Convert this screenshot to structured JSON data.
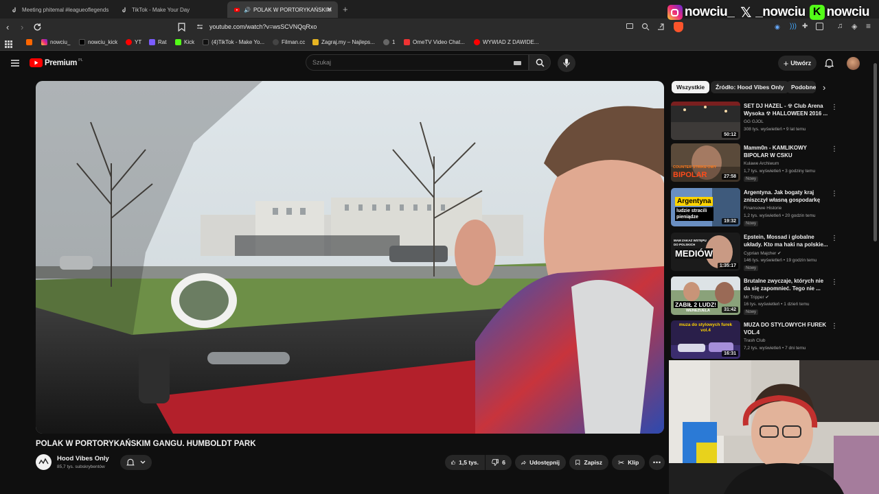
{
  "tabs": [
    {
      "label": "Meeting phitemal #leagueoflegends",
      "active": false
    },
    {
      "label": "TikTok - Make Your Day",
      "active": false
    },
    {
      "label": "POLAK W PORTORYKAŃSKIM",
      "active": true
    }
  ],
  "address": {
    "url": "youtube.com/watch?v=wsSCVNQqRxo"
  },
  "bookmarks": [
    "nowciu_",
    "nowciu_kick",
    "YT",
    "Rat",
    "Kick",
    "(4)TikTok - Make Yo...",
    "Filman.cc",
    "Zagraj.my – Najleps...",
    "1",
    "OmeTV Video Chat...",
    "WYWIAD Z DAWIDE..."
  ],
  "youtube": {
    "logo_text": "Premium",
    "logo_sup": "PL",
    "search_placeholder": "Szukaj",
    "create_label": "Utwórz"
  },
  "chips": [
    "Wszystkie",
    "Źródło: Hood Vibes Only",
    "Podobne"
  ],
  "recommendations": [
    {
      "title": "SET DJ HAZEL - ☢ Club Arena Wysoka ☢ HALLOWEEN 2016 ...",
      "channel": "GG GJOL",
      "meta": "308 tys. wyświetleń • 9 lat temu",
      "duration": "50:12",
      "badge": "",
      "verified": false
    },
    {
      "title": "Mamm0n - KAMLIKOWY BIPOLAR W CSKU",
      "channel": "Kulawe Archiwum",
      "meta": "1,7 tys. wyświetleń • 3 godziny temu",
      "duration": "27:58",
      "badge": "Nowy",
      "verified": false
    },
    {
      "title": "Argentyna. Jak bogaty kraj zniszczył własną gospodarkę",
      "channel": "Finansowe Historie",
      "meta": "1,2 tys. wyświetleń • 20 godzin temu",
      "duration": "19:32",
      "badge": "Nowy",
      "verified": false
    },
    {
      "title": "Epstein, Mossad i globalne układy. Kto ma haki na polskie...",
      "channel": "Cyprian Majcher",
      "meta": "146 tys. wyświetleń • 19 godzin temu",
      "duration": "1:35:17",
      "badge": "Nowy",
      "verified": true
    },
    {
      "title": "Brutalne zwyczaje, których nie da się zapomnieć. Tego nie ...",
      "channel": "Mr Tripper",
      "meta": "16 tys. wyświetleń • 1 dzień temu",
      "duration": "31:42",
      "badge": "Nowy",
      "verified": true
    },
    {
      "title": "MUZA DO STYLOWYCH FUREK VOL.4",
      "channel": "Trash Club",
      "meta": "7,2 tys. wyświetleń • 7 dni temu",
      "duration": "16:31",
      "badge": "",
      "verified": false
    }
  ],
  "thumb_texts": {
    "t2": "COUNTER STRIKE'OWY",
    "t2b": "BIPOLAR",
    "t3a": "Argentyna",
    "t3b": "ludzie stracili pieniądze",
    "t4a": "MAM ZAKAZ WSTĘPU DO POLSKICH",
    "t4b": "MEDIÓW",
    "t5a": "ZABIŁ 2 LUDZ!",
    "t5b": "WENEZUELA",
    "t6": "muza do stylowych furek vol.4"
  },
  "video": {
    "title": "POLAK W PORTORYKAŃSKIM GANGU. HUMBOLDT PARK",
    "channel": "Hood Vibes Only",
    "subscribers": "85,7 tys. subskrybentów",
    "likes": "1,5 tys.",
    "dislikes": "6",
    "share": "Udostępnij",
    "save": "Zapisz",
    "clip": "Klip"
  },
  "overlay": {
    "instagram": "nowciu_",
    "x": "_nowciu",
    "kick": "nowciu"
  },
  "colors": {
    "yt_red": "#ff0000",
    "chip_selected": "#f1f1f1",
    "bg": "#0f0f0f",
    "kick_green": "#53fc18"
  }
}
